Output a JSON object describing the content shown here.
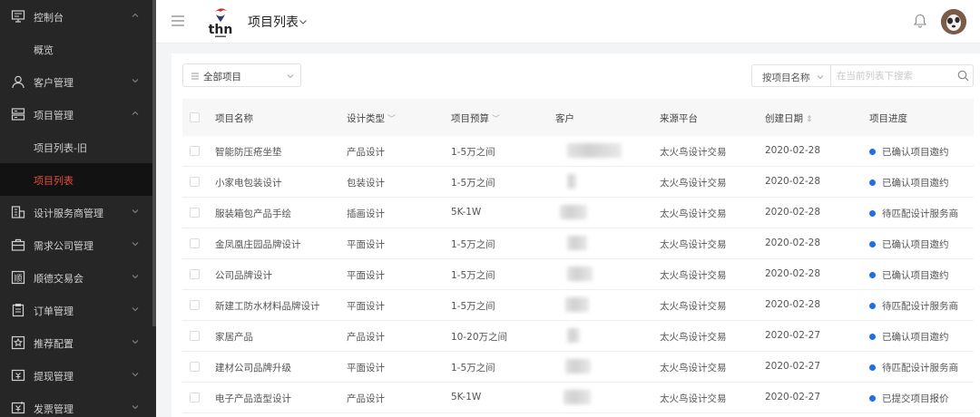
{
  "sidebar": {
    "items": [
      {
        "label": "控制台",
        "icon": "monitor-icon",
        "expanded": true
      },
      {
        "label": "概览",
        "sub": true
      },
      {
        "label": "客户管理",
        "icon": "user-icon",
        "expanded": false
      },
      {
        "label": "项目管理",
        "icon": "project-icon",
        "expanded": true
      },
      {
        "label": "项目列表-旧",
        "sub": true
      },
      {
        "label": "项目列表",
        "sub": true,
        "active": true
      },
      {
        "label": "设计服务商管理",
        "icon": "building-icon",
        "expanded": false
      },
      {
        "label": "需求公司管理",
        "icon": "briefcase-icon",
        "expanded": false
      },
      {
        "label": "顺德交易会",
        "icon": "fair-icon",
        "expanded": false
      },
      {
        "label": "订单管理",
        "icon": "clipboard-icon",
        "expanded": false
      },
      {
        "label": "推荐配置",
        "icon": "recommend-icon",
        "expanded": false
      },
      {
        "label": "提现管理",
        "icon": "withdraw-icon",
        "expanded": false
      },
      {
        "label": "发票管理",
        "icon": "invoice-icon",
        "expanded": false
      }
    ]
  },
  "header": {
    "title": "项目列表"
  },
  "toolbar": {
    "filter_label": "全部项目",
    "search_by": "按项目名称",
    "search_placeholder": "在当前列表下搜索"
  },
  "table": {
    "columns": [
      "项目名称",
      "设计类型",
      "项目预算",
      "客户",
      "来源平台",
      "创建日期",
      "项目进度"
    ],
    "rows": [
      {
        "name": "智能防压疮坐垫",
        "type": "产品设计",
        "budget": "1-5万之间",
        "platform": "太火鸟设计交易",
        "date": "2020-02-28",
        "status": "已确认项目邀约"
      },
      {
        "name": "小家电包装设计",
        "type": "包装设计",
        "budget": "1-5万之间",
        "platform": "太火鸟设计交易",
        "date": "2020-02-28",
        "status": "已确认项目邀约"
      },
      {
        "name": "服装箱包产品手绘",
        "type": "插画设计",
        "budget": "5K-1W",
        "platform": "太火鸟设计交易",
        "date": "2020-02-28",
        "status": "待匹配设计服务商"
      },
      {
        "name": "金凤凰庄园品牌设计",
        "type": "平面设计",
        "budget": "1-5万之间",
        "platform": "太火鸟设计交易",
        "date": "2020-02-28",
        "status": "已确认项目邀约"
      },
      {
        "name": "公司品牌设计",
        "type": "平面设计",
        "budget": "1-5万之间",
        "platform": "太火鸟设计交易",
        "date": "2020-02-28",
        "status": "已确认项目邀约"
      },
      {
        "name": "新建工防水材料品牌设计",
        "type": "平面设计",
        "budget": "1-5万之间",
        "platform": "太火鸟设计交易",
        "date": "2020-02-28",
        "status": "待匹配设计服务商"
      },
      {
        "name": "家居产品",
        "type": "产品设计",
        "budget": "10-20万之间",
        "platform": "太火鸟设计交易",
        "date": "2020-02-27",
        "status": "已确认项目邀约"
      },
      {
        "name": "建材公司品牌升级",
        "type": "平面设计",
        "budget": "1-5万之间",
        "platform": "太火鸟设计交易",
        "date": "2020-02-27",
        "status": "待匹配设计服务商"
      },
      {
        "name": "电子产品造型设计",
        "type": "产品设计",
        "budget": "5K-1W",
        "platform": "太火鸟设计交易",
        "date": "2020-02-27",
        "status": "已提交项目报价"
      }
    ]
  },
  "colors": {
    "sidebar_bg": "#262626",
    "active_text": "#e74c3c",
    "status_dot": "#1f6fe0"
  }
}
